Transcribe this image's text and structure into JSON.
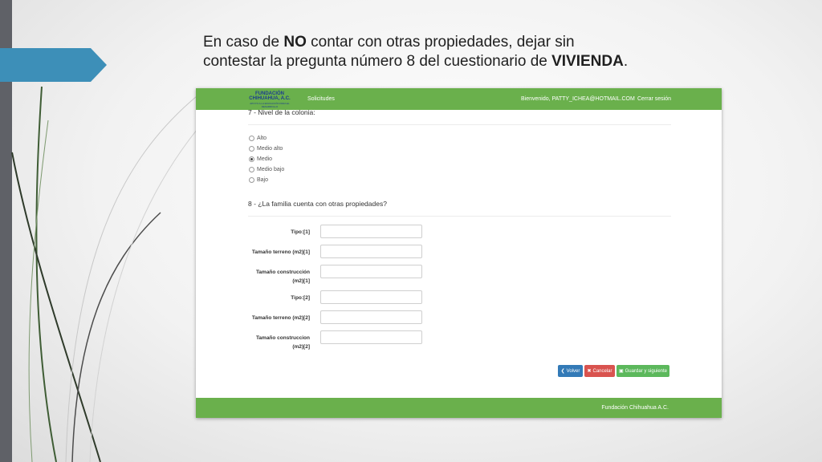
{
  "slide": {
    "heading_line1_pre": "En caso de ",
    "heading_line1_bold": "NO",
    "heading_line1_post": " contar con otras propiedades, dejar sin",
    "heading_line2_pre": "contestar la pregunta número 8 del cuestionario de ",
    "heading_line2_bold": "VIVIENDA",
    "heading_line2_post": ".",
    "accent_color": "#3d8fb8",
    "bar_color": "#5f6167"
  },
  "app": {
    "navbar": {
      "logo_line1": "FUNDACIÓN",
      "logo_line2": "CHIHUAHUA, A.C.",
      "logo_line3": "APOYO A LA EDUCACIÓN PARA EL DESARROLLO",
      "nav_solicitudes": "Solicitudes",
      "welcome": "Bienvenido, PATTY_ICHEA@HOTMAIL.COM",
      "logout": "Cerrar sesión",
      "color": "#6ab04c"
    },
    "q7": {
      "title": "7 - Nivel de la colonia:",
      "options": [
        {
          "label": "Alto",
          "checked": false
        },
        {
          "label": "Medio alto",
          "checked": false
        },
        {
          "label": "Medio",
          "checked": true
        },
        {
          "label": "Medio bajo",
          "checked": false
        },
        {
          "label": "Bajo",
          "checked": false
        }
      ]
    },
    "q8": {
      "title": "8 - ¿La familia cuenta con otras propiedades?",
      "fields": [
        {
          "label": "Tipo:[1]",
          "value": ""
        },
        {
          "label": "Tamaño terreno (m2)[1]",
          "value": ""
        },
        {
          "label_line1": "Tamaño construcción",
          "label_line2": "(m2)[1]",
          "value": ""
        },
        {
          "label": "Tipo:[2]",
          "value": ""
        },
        {
          "label": "Tamaño terreno (m2)[2]",
          "value": ""
        },
        {
          "label_line1": "Tamaño construccion",
          "label_line2": "(m2)[2]",
          "value": ""
        }
      ]
    },
    "buttons": {
      "back_icon": "chevron-left-icon",
      "back": "Volver",
      "cancel_icon": "close-icon",
      "cancel": "Cancelar",
      "save_icon": "floppy-disk-icon",
      "save": "Guardar y siguiente"
    },
    "footer": {
      "text": "Fundación Chihuahua A.C."
    }
  }
}
